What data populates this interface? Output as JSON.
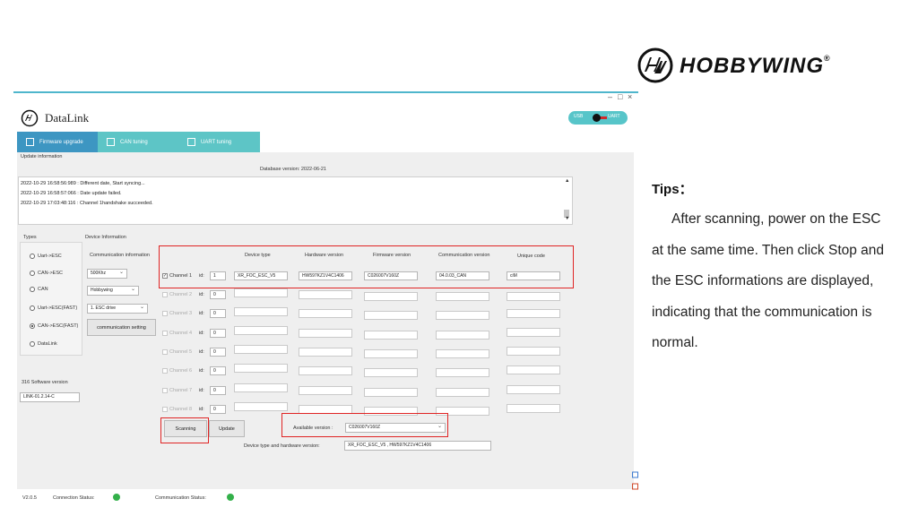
{
  "brand": {
    "name": "HOBBYWING",
    "reg": "®"
  },
  "tips": {
    "title": "Tips：",
    "body": "After scanning,  power on the ESC at the same time. Then click Stop and the ESC informations are displayed, indicating that the communication is normal."
  },
  "window": {
    "title": "DataLink",
    "controls": {
      "minimize": "–",
      "maximize": "□",
      "close": "×"
    },
    "toggle": {
      "left": "USB",
      "right": "UART"
    }
  },
  "tabs": [
    {
      "label": "Firmware upgrade",
      "active": true
    },
    {
      "label": "CAN tuning",
      "active": false
    },
    {
      "label": "UART tuning",
      "active": false
    }
  ],
  "update": {
    "section_label": "Update information",
    "db_version": "Database version: 2022-06-21",
    "log": [
      "2022-10-29 16:58:56:989 : Different date, Start syncing...",
      "2022-10-29 16:58:57:066 : Date update failed.",
      "2022-10-29 17:03:48:116 : Channel  1handshake succeeded."
    ]
  },
  "types": {
    "label": "Types",
    "options": [
      "Uart->ESC",
      "CAN->ESC",
      "CAN",
      "Uart->ESC(FAST)",
      "CAN->ESC(FAST)",
      "DataLink"
    ],
    "selected": "CAN->ESC(FAST)"
  },
  "software": {
    "label": "316 Software version",
    "value": "LINK-01.2.14-C"
  },
  "device_info": {
    "label": "Device Information",
    "comm_info_label": "Communication information",
    "baud": "500Khz",
    "brand_select": "Hobbywing",
    "drive_select": "1. ESC drive",
    "comm_setting_button": "communication setting"
  },
  "table": {
    "headers": [
      "Device type",
      "Hardware version",
      "Firmware version",
      "Communication version",
      "Unique code"
    ],
    "id_label": "id:",
    "channels": [
      {
        "label": "Channel 1",
        "checked": true,
        "enabled": true,
        "id": "1",
        "device_type": "XR_FOC_ESC_V5",
        "hardware": "HW597KZ1V4C1406",
        "firmware": "C026007V160Z",
        "comm": "04.0.03_CAN",
        "unique": "ciM"
      },
      {
        "label": "Channel 2",
        "checked": false,
        "enabled": false,
        "id": "0",
        "device_type": "",
        "hardware": "",
        "firmware": "",
        "comm": "",
        "unique": ""
      },
      {
        "label": "Channel 3",
        "checked": false,
        "enabled": false,
        "id": "0",
        "device_type": "",
        "hardware": "",
        "firmware": "",
        "comm": "",
        "unique": ""
      },
      {
        "label": "Channel 4",
        "checked": false,
        "enabled": false,
        "id": "0",
        "device_type": "",
        "hardware": "",
        "firmware": "",
        "comm": "",
        "unique": ""
      },
      {
        "label": "Channel 5",
        "checked": false,
        "enabled": false,
        "id": "0",
        "device_type": "",
        "hardware": "",
        "firmware": "",
        "comm": "",
        "unique": ""
      },
      {
        "label": "Channel 6",
        "checked": false,
        "enabled": false,
        "id": "0",
        "device_type": "",
        "hardware": "",
        "firmware": "",
        "comm": "",
        "unique": ""
      },
      {
        "label": "Channel 7",
        "checked": false,
        "enabled": false,
        "id": "0",
        "device_type": "",
        "hardware": "",
        "firmware": "",
        "comm": "",
        "unique": ""
      },
      {
        "label": "Channel 8",
        "checked": false,
        "enabled": false,
        "id": "0",
        "device_type": "",
        "hardware": "",
        "firmware": "",
        "comm": "",
        "unique": ""
      }
    ]
  },
  "actions": {
    "scanning": "Scanning",
    "update": "Update",
    "available_label": "Available version :",
    "available_value": "C026007V160Z",
    "device_hw_label": "Device type and hardware version:",
    "device_hw_value": "XR_FOC_ESC_V5  ,    HW597KZ1V4C1406"
  },
  "status": {
    "version": "V2.0.5",
    "connection_label": "Connection Status:",
    "communication_label": "Communication Status:",
    "connection_color": "#33b04a",
    "communication_color": "#33b04a"
  },
  "colors": {
    "accent": "#5dc5c6",
    "active_tab": "#3d96c2",
    "highlight": "#e02424"
  }
}
